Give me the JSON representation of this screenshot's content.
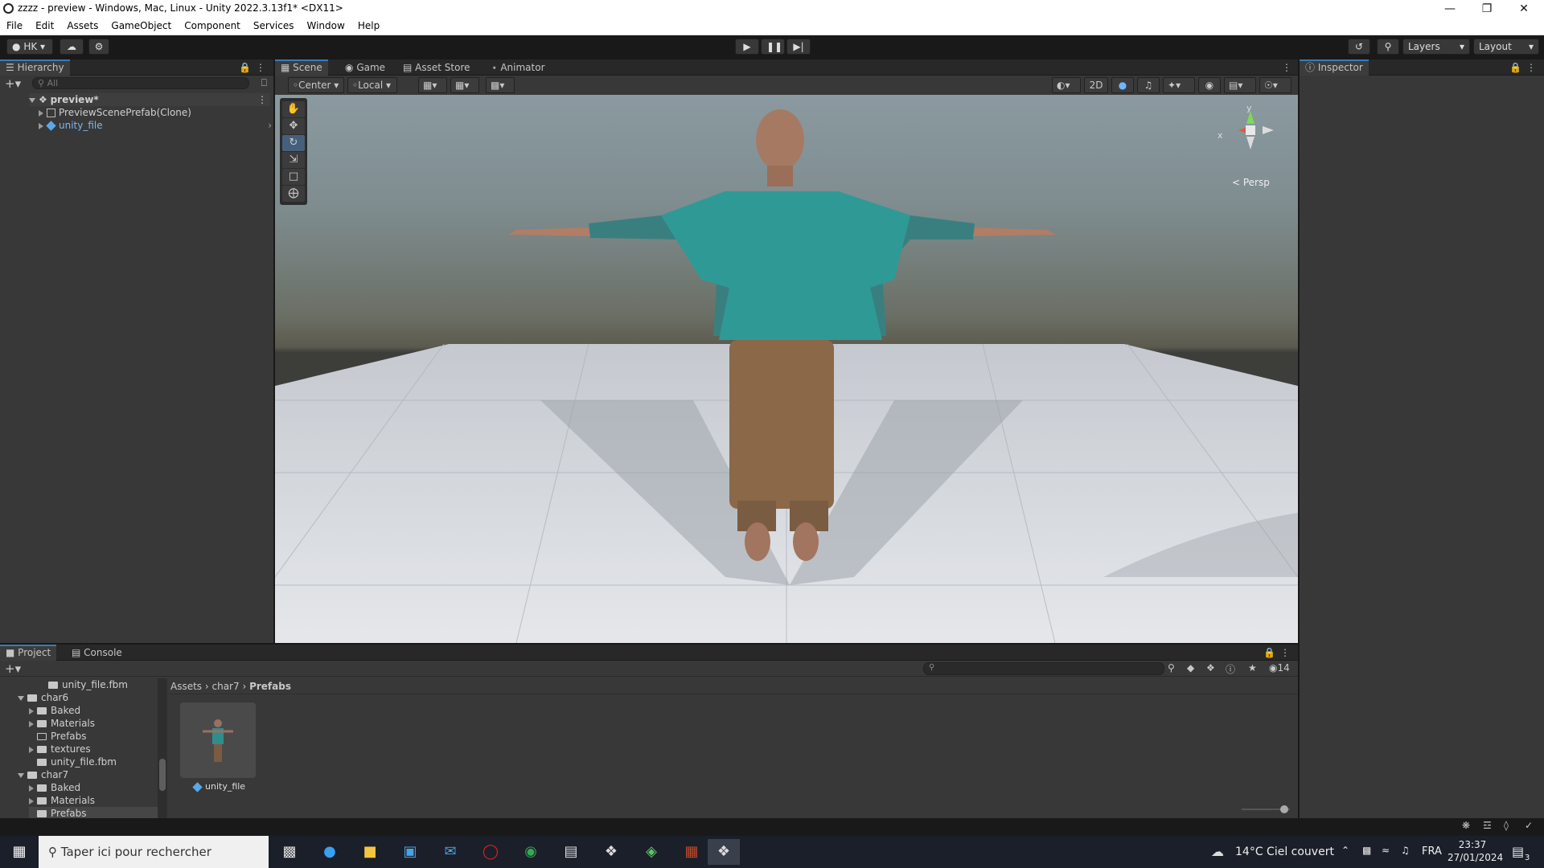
{
  "window": {
    "title": "zzzz - preview - Windows, Mac, Linux - Unity 2022.3.13f1* <DX11>"
  },
  "menu": [
    "File",
    "Edit",
    "Assets",
    "GameObject",
    "Component",
    "Services",
    "Window",
    "Help"
  ],
  "toolbar": {
    "account": "HK",
    "layers": "Layers",
    "layout": "Layout"
  },
  "hierarchy": {
    "tab": "Hierarchy",
    "search_placeholder": "All",
    "scene_name": "preview*",
    "items": [
      "PreviewScenePrefab(Clone)",
      "unity_file"
    ]
  },
  "scene": {
    "tabs": [
      "Scene",
      "Game",
      "Asset Store",
      "Animator"
    ],
    "pivot": "Center",
    "space": "Local",
    "mode_2d": "2D",
    "gizmo_y": "y",
    "gizmo_x": "x",
    "projection": "< Persp"
  },
  "inspector": {
    "tab": "Inspector"
  },
  "project": {
    "tabs": [
      "Project",
      "Console"
    ],
    "tree": [
      {
        "label": "unity_file.fbm",
        "indent": 3,
        "arrow": "none"
      },
      {
        "label": "char6",
        "indent": 1,
        "arrow": "down"
      },
      {
        "label": "Baked",
        "indent": 2,
        "arrow": "right"
      },
      {
        "label": "Materials",
        "indent": 2,
        "arrow": "right"
      },
      {
        "label": "Prefabs",
        "indent": 2,
        "arrow": "none"
      },
      {
        "label": "textures",
        "indent": 2,
        "arrow": "right"
      },
      {
        "label": "unity_file.fbm",
        "indent": 2,
        "arrow": "none"
      },
      {
        "label": "char7",
        "indent": 1,
        "arrow": "down"
      },
      {
        "label": "Baked",
        "indent": 2,
        "arrow": "right"
      },
      {
        "label": "Materials",
        "indent": 2,
        "arrow": "right"
      },
      {
        "label": "Prefabs",
        "indent": 2,
        "arrow": "none"
      }
    ],
    "breadcrumb": [
      "Assets",
      "char7",
      "Prefabs"
    ],
    "asset_name": "unity_file",
    "hidden_count": "14"
  },
  "taskbar": {
    "search_placeholder": "Taper ici pour rechercher",
    "weather": "14°C  Ciel couvert",
    "language": "FRA",
    "time": "23:37",
    "date": "27/01/2024",
    "notifications": "3"
  }
}
